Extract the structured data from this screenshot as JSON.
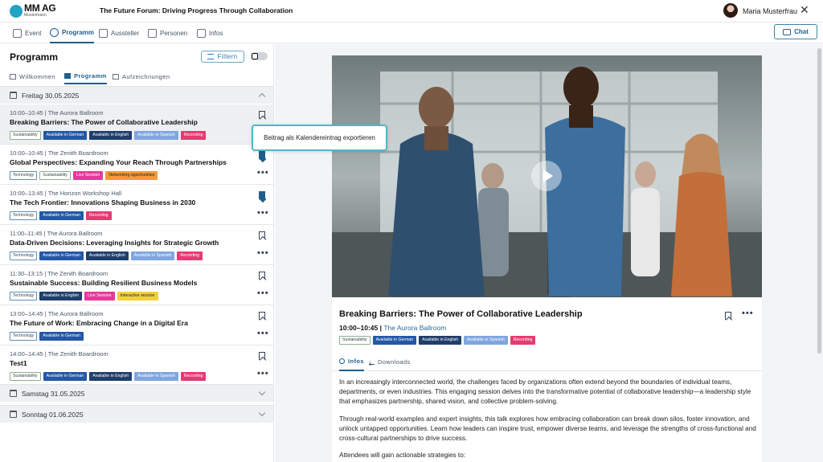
{
  "header": {
    "logo_text": "MM AG",
    "logo_sub": "Mustermann",
    "event_title": "The Future Forum: Driving Progress Through Collaboration",
    "user_name": "Maria Musterfrau"
  },
  "nav": {
    "tabs": [
      {
        "label": "Event",
        "icon": "home-icon"
      },
      {
        "label": "Programm",
        "icon": "clock-icon",
        "active": true
      },
      {
        "label": "Aussteller",
        "icon": "monitor-icon"
      },
      {
        "label": "Personen",
        "icon": "people-icon"
      },
      {
        "label": "Infos",
        "icon": "chat-bubble-icon"
      }
    ],
    "chat_label": "Chat"
  },
  "program": {
    "title": "Programm",
    "filter_label": "Filtern",
    "subtabs": [
      {
        "label": "Willkommen"
      },
      {
        "label": "Programm",
        "active": true
      },
      {
        "label": "Aufzeichnungen"
      }
    ],
    "days": [
      {
        "label": "Freitag 30.05.2025",
        "open": true
      },
      {
        "label": "Samstag 31.05.2025",
        "open": false
      },
      {
        "label": "Sonntag 01.06.2025",
        "open": false
      }
    ],
    "sessions": [
      {
        "time": "10:00–10:45 | The Aurora Ballroom",
        "title": "Breaking Barriers: The Power of Collaborative Leadership",
        "tags": [
          "Sustainability",
          "Available in German",
          "Available in English",
          "Available in Spanish",
          "Recording"
        ],
        "bookmarked": false,
        "selected": true
      },
      {
        "time": "10:00–10:45 | The Zenith Boardroom",
        "title": "Global Perspectives: Expanding Your Reach Through Partnerships",
        "tags": [
          "Technology",
          "Sustainability",
          "Live Session",
          "Networking opportunities"
        ],
        "bookmarked": true
      },
      {
        "time": "10:00–13:45 | The Horizon Workshop Hall",
        "title": "The Tech Frontier: Innovations Shaping Business in 2030",
        "tags": [
          "Technology",
          "Available in German",
          "Recording"
        ],
        "bookmarked": true
      },
      {
        "time": "11:00–11:45 | The Aurora Ballroom",
        "title": "Data-Driven Decisions: Leveraging Insights for Strategic Growth",
        "tags": [
          "Technology",
          "Available in German",
          "Available in English",
          "Available in Spanish",
          "Recording"
        ],
        "bookmarked": false
      },
      {
        "time": "11:30–13:15 | The Zenith Boardroom",
        "title": "Sustainable Success: Building Resilient Business Models",
        "tags": [
          "Technology",
          "Available in English",
          "Live Session",
          "Interactive session"
        ],
        "bookmarked": false
      },
      {
        "time": "13:00–14:45 | The Aurora Ballroom",
        "title": "The Future of Work: Embracing Change in a Digital Era",
        "tags": [
          "Technology",
          "Available in German"
        ],
        "bookmarked": false
      },
      {
        "time": "14:00–14:45 | The Zenith Boardroom",
        "title": "Test1",
        "tags": [
          "Sustainability",
          "Available in German",
          "Available in English",
          "Available in Spanish",
          "Recording"
        ],
        "bookmarked": false
      }
    ],
    "tooltip": "Beitrag als Kalendereintrag exportieren"
  },
  "detail": {
    "title": "Breaking Barriers: The Power of Collaborative Leadership",
    "time": "10:00–10:45 |",
    "room": "The Aurora Ballroom",
    "tags": [
      "Sustainability",
      "Available in German",
      "Available in English",
      "Available in Spanish",
      "Recording"
    ],
    "tabs": [
      {
        "label": "Infos",
        "active": true
      },
      {
        "label": "Downloads"
      }
    ],
    "paragraphs": [
      "In an increasingly interconnected world, the challenges faced by organizations often extend beyond the boundaries of individual teams, departments, or even industries. This engaging session delves into the transformative potential of collaborative leadership—a leadership style that emphasizes partnership, shared vision, and collective problem-solving.",
      "Through real-world examples and expert insights, this talk explores how embracing collaboration can break down silos, foster innovation, and unlock untapped opportunities. Learn how leaders can inspire trust, empower diverse teams, and leverage the strengths of cross-functional and cross-cultural partnerships to drive success.",
      "Attendees will gain actionable strategies to:"
    ]
  },
  "tag_styles": {
    "Sustainability": "t-sust",
    "Technology": "t-tech",
    "Available in German": "t-ger",
    "Available in English": "t-eng",
    "Available in Spanish": "t-spa",
    "Recording": "t-rec",
    "Live Session": "t-live",
    "Networking opportunities": "t-net",
    "Interactive session": "t-int"
  },
  "colors": {
    "accent": "#1f5f8b",
    "logo": "#22a4c3",
    "tooltip_border": "#4fb8c8"
  }
}
